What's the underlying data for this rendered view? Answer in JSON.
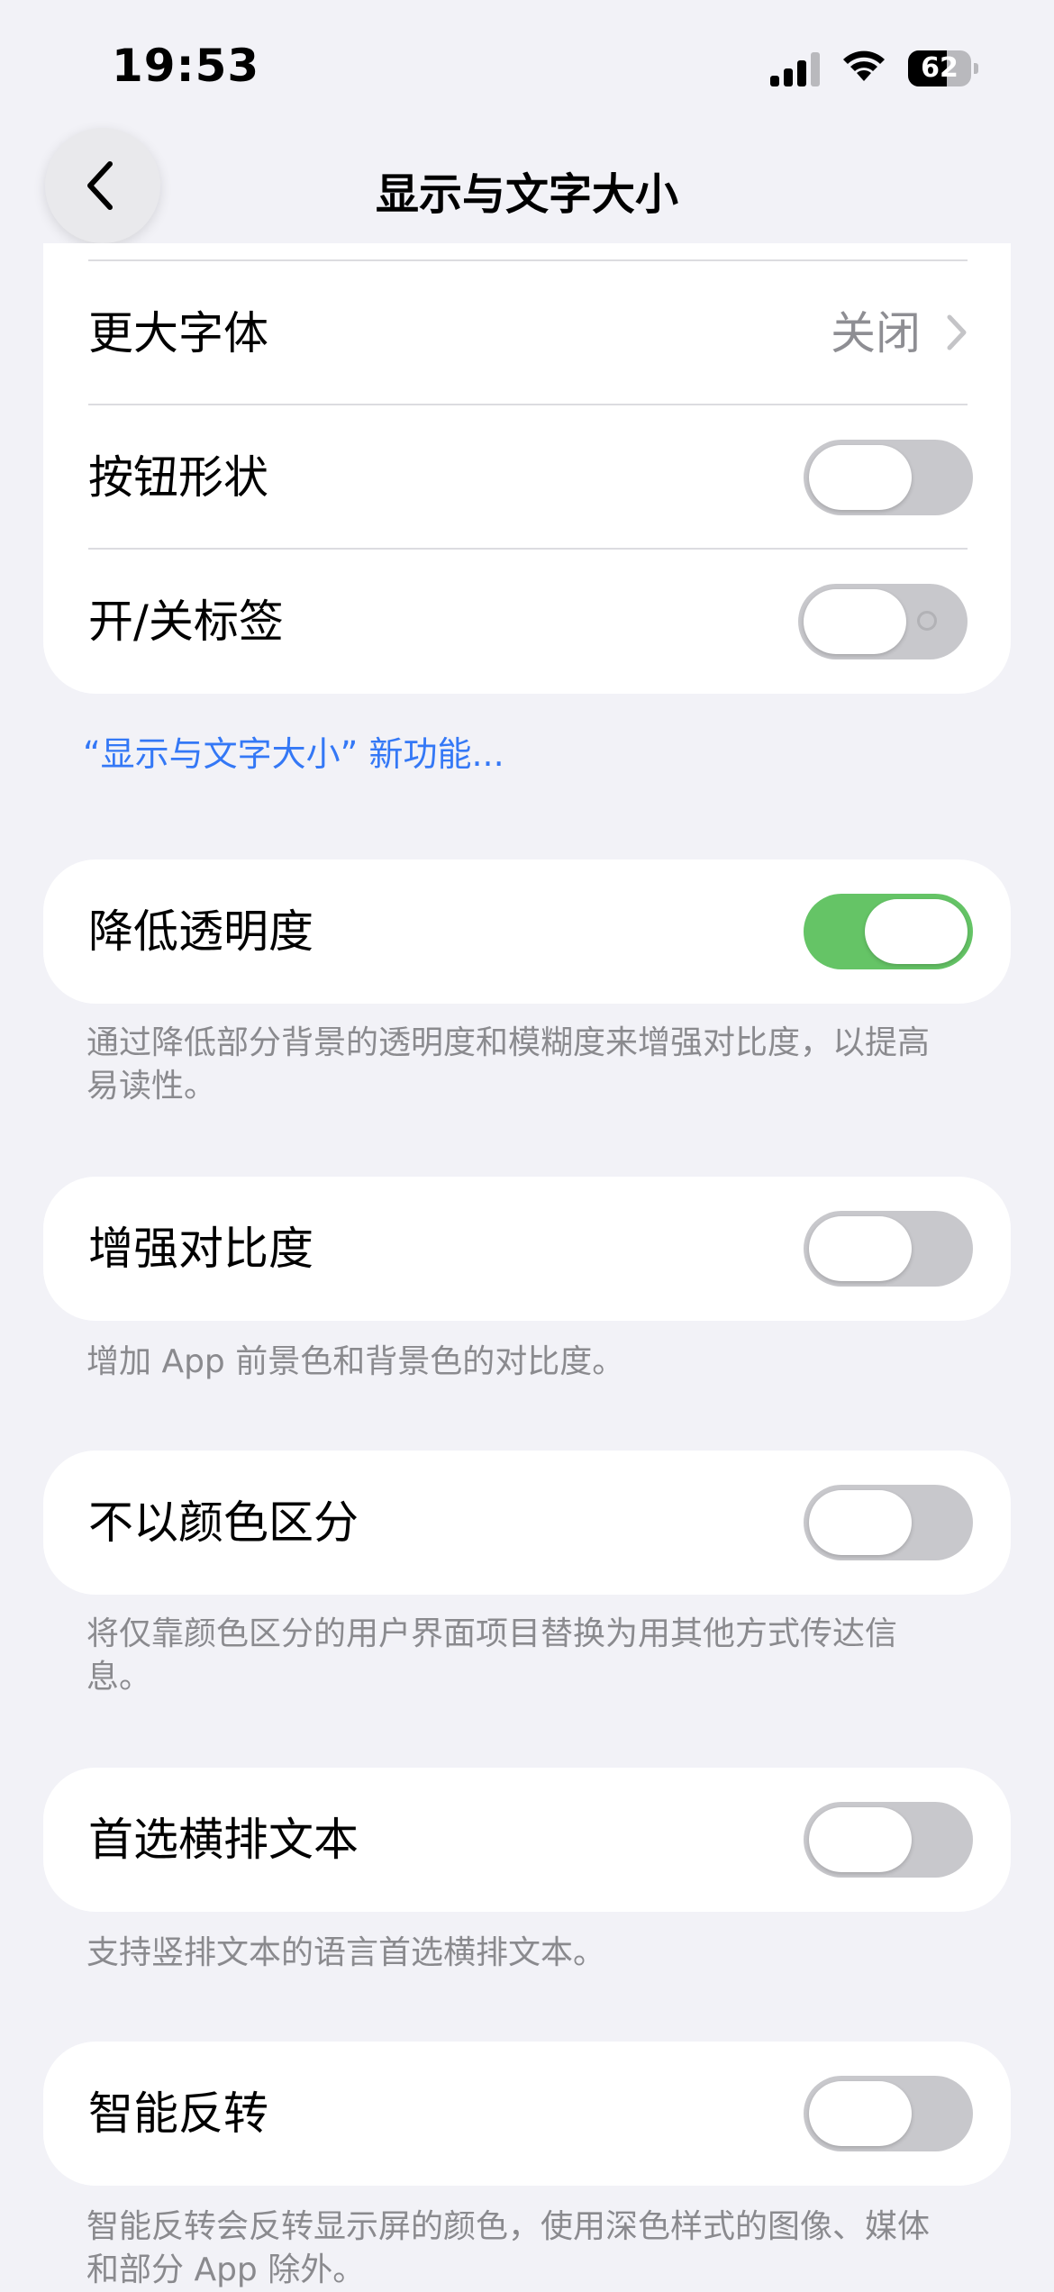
{
  "status": {
    "time": "19:53",
    "battery": "62",
    "battery_fraction": 0.62
  },
  "nav": {
    "title": "显示与文字大小"
  },
  "top_section": {
    "larger_text": {
      "label": "更大字体",
      "value": "关闭"
    },
    "button_shapes": {
      "label": "按钮形状",
      "on": false
    },
    "on_off_labels": {
      "label": "开/关标签",
      "on": false
    }
  },
  "whats_new_link": "“显示与文字大小” 新功能...",
  "settings": [
    {
      "label": "降低透明度",
      "on": true,
      "footer": "通过降低部分背景的透明度和模糊度来增强对比度，以提高易读性。"
    },
    {
      "label": "增强对比度",
      "on": false,
      "footer": "增加 App 前景色和背景色的对比度。"
    },
    {
      "label": "不以颜色区分",
      "on": false,
      "footer": "将仅靠颜色区分的用户界面项目替换为用其他方式传达信息。"
    },
    {
      "label": "首选横排文本",
      "on": false,
      "footer": "支持竖排文本的语言首选横排文本。"
    },
    {
      "label": "智能反转",
      "on": false,
      "footer": "智能反转会反转显示屏的颜色，使用深色样式的图像、媒体和部分 App 除外。"
    }
  ],
  "colors": {
    "accent": "#3478f6",
    "toggle_on": "#65c466",
    "toggle_off": "#c8c8cc",
    "background": "#f2f2f7"
  }
}
